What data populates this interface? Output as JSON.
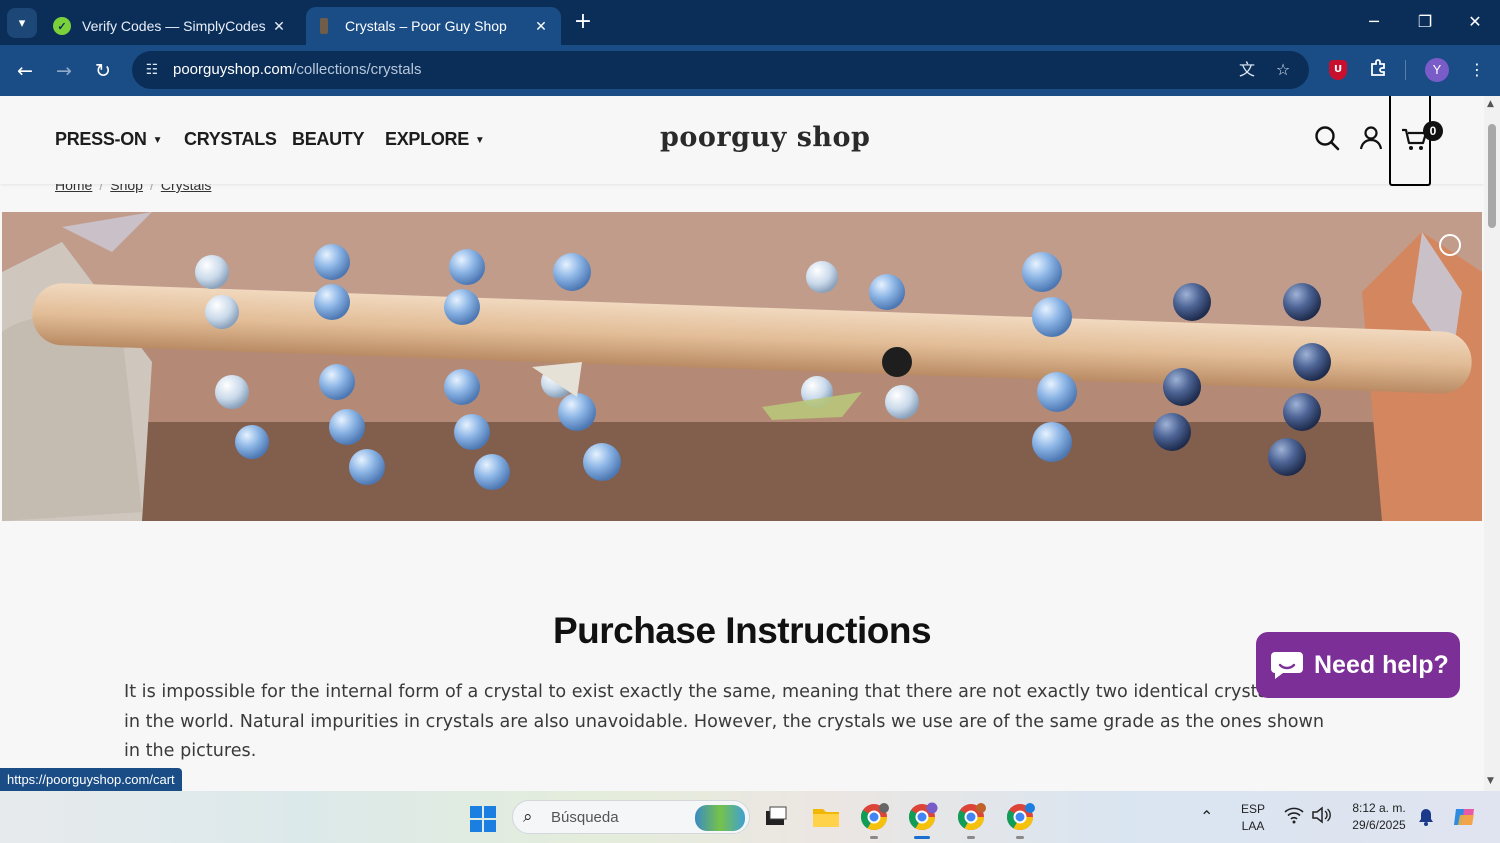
{
  "browser": {
    "tabs": [
      {
        "title": "Verify Codes — SimplyCodes",
        "close": "✕"
      },
      {
        "title": "Crystals – Poor Guy Shop",
        "close": "✕"
      }
    ],
    "new_tab": "+",
    "window_controls": {
      "minimize": "─",
      "restore": "❐",
      "close": "✕"
    },
    "url_host": "poorguyshop.com",
    "url_path": "/collections/crystals",
    "profile_initial": "Y",
    "ublock_label": "U",
    "status_url": "https://poorguyshop.com/cart"
  },
  "site": {
    "nav": [
      {
        "label": "PRESS-ON",
        "has_dropdown": true
      },
      {
        "label": "CRYSTALS",
        "has_dropdown": false
      },
      {
        "label": "BEAUTY",
        "has_dropdown": false
      },
      {
        "label": "EXPLORE",
        "has_dropdown": true
      }
    ],
    "logo": "poorguy shop",
    "cart_count": "0",
    "breadcrumb": [
      "Home",
      "Shop",
      "Crystals"
    ],
    "heading": "Purchase Instructions",
    "paragraph": "It is impossible for the internal form of a crystal to exist exactly the same, meaning that there are not exactly two identical crystal beads in the world. Natural impurities in crystals are also unavoidable. However, the crystals we use are of the same grade as the ones shown in the pictures.",
    "help_button": "Need help?"
  },
  "taskbar": {
    "search_placeholder": "Búsqueda",
    "lang_top": "ESP",
    "lang_bottom": "LAA",
    "time": "8:12 a. m.",
    "date": "29/6/2025"
  },
  "colors": {
    "chrome_dark": "#0b2e59",
    "chrome_toolbar": "#1a4d86",
    "help_purple": "#7b2f97",
    "page_bg": "#f7f7f7"
  }
}
